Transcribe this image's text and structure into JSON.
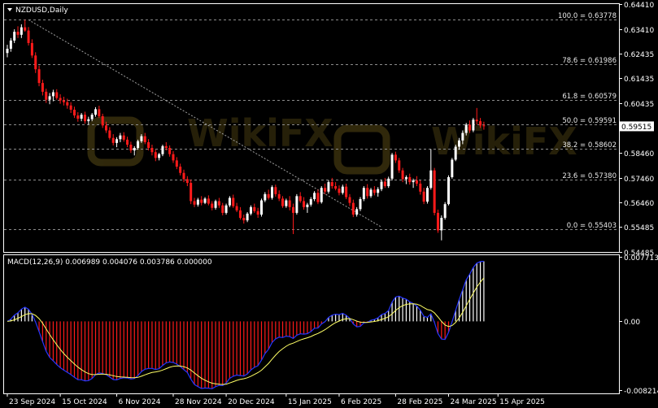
{
  "window": {
    "symbol_title": "NZDUSD,Daily",
    "indicator_title": "MACD(12,26,9) 0.006989 0.004076 0.003786 0.000000"
  },
  "colors": {
    "background": "#000000",
    "grid": "#8c8c8c",
    "bull_candle": "#ffffff",
    "bear_candle": "#ff1a1a",
    "trendline": "#a0a0a0",
    "macd_line": "#2636ff",
    "signal_line": "#ffff66",
    "hist_pos": "#ffffff",
    "hist_neg": "#ff1a1a",
    "price_tag_bg": "#ffffff",
    "price_tag_text": "#000000",
    "watermark": "#6b5a1a"
  },
  "chart_data": [
    {
      "type": "candlestick",
      "symbol": "NZDUSD",
      "timeframe": "Daily",
      "ylim": [
        0.54485,
        0.6441
      ],
      "price_ticks": [
        "0.64410",
        "0.63410",
        "0.62435",
        "0.61435",
        "0.60435",
        "0.59515",
        "0.58460",
        "0.57460",
        "0.56460",
        "0.55485",
        "0.54485"
      ],
      "current_price": "0.59515",
      "x_ticks": [
        "23 Sep 2024",
        "15 Oct 2024",
        "6 Nov 2024",
        "28 Nov 2024",
        "20 Dec 2024",
        "15 Jan 2025",
        "6 Feb 2025",
        "28 Feb 2025",
        "24 Mar 2025",
        "15 Apr 2025"
      ],
      "fibonacci": [
        {
          "label": "100.0 = 0.63778",
          "price": 0.63778
        },
        {
          "label": "78.6 = 0.61986",
          "price": 0.61986
        },
        {
          "label": "61.8 = 0.60579",
          "price": 0.60579
        },
        {
          "label": "50.0 = 0.59591",
          "price": 0.59591
        },
        {
          "label": "38.2 = 0.58602",
          "price": 0.58602
        },
        {
          "label": "23.6 = 0.57380",
          "price": 0.5738
        },
        {
          "label": "0.0 = 0.55403",
          "price": 0.55403
        }
      ],
      "trendline": {
        "from_index": 6,
        "from_price": 0.6378,
        "to_index": 106,
        "to_price": 0.5548
      },
      "candles": [
        [
          0.6245,
          0.6278,
          0.6228,
          0.6262
        ],
        [
          0.6262,
          0.6305,
          0.625,
          0.6295
        ],
        [
          0.6295,
          0.634,
          0.6285,
          0.633
        ],
        [
          0.633,
          0.6352,
          0.6305,
          0.6318
        ],
        [
          0.6318,
          0.636,
          0.6305,
          0.6348
        ],
        [
          0.6348,
          0.6378,
          0.633,
          0.6335
        ],
        [
          0.6335,
          0.6349,
          0.6275,
          0.6285
        ],
        [
          0.6285,
          0.63,
          0.6225,
          0.6235
        ],
        [
          0.6235,
          0.6248,
          0.6165,
          0.618
        ],
        [
          0.618,
          0.6195,
          0.6112,
          0.6125
        ],
        [
          0.6125,
          0.6138,
          0.6075,
          0.609
        ],
        [
          0.609,
          0.6102,
          0.6045,
          0.6058
        ],
        [
          0.6058,
          0.6085,
          0.604,
          0.6072
        ],
        [
          0.6072,
          0.6098,
          0.6052,
          0.6088
        ],
        [
          0.6088,
          0.61,
          0.6058,
          0.6065
        ],
        [
          0.6065,
          0.608,
          0.6042,
          0.6055
        ],
        [
          0.6055,
          0.607,
          0.6035,
          0.6048
        ],
        [
          0.6048,
          0.6062,
          0.6022,
          0.6035
        ],
        [
          0.6035,
          0.6048,
          0.6005,
          0.6018
        ],
        [
          0.6018,
          0.603,
          0.5985,
          0.5995
        ],
        [
          0.5995,
          0.6008,
          0.597,
          0.5982
        ],
        [
          0.5982,
          0.6005,
          0.5972,
          0.5998
        ],
        [
          0.5998,
          0.601,
          0.5962,
          0.5972
        ],
        [
          0.5972,
          0.599,
          0.5958,
          0.598
        ],
        [
          0.598,
          0.6005,
          0.5972,
          0.5998
        ],
        [
          0.5998,
          0.6028,
          0.599,
          0.602
        ],
        [
          0.602,
          0.6034,
          0.5985,
          0.5992
        ],
        [
          0.5992,
          0.6002,
          0.5945,
          0.5955
        ],
        [
          0.5955,
          0.597,
          0.5925,
          0.5935
        ],
        [
          0.5935,
          0.5948,
          0.5898,
          0.5905
        ],
        [
          0.5905,
          0.592,
          0.5875,
          0.5885
        ],
        [
          0.5885,
          0.5908,
          0.5868,
          0.59
        ],
        [
          0.59,
          0.5925,
          0.5888,
          0.5915
        ],
        [
          0.5915,
          0.5928,
          0.589,
          0.5898
        ],
        [
          0.5898,
          0.591,
          0.5868,
          0.5878
        ],
        [
          0.5878,
          0.589,
          0.5845,
          0.5855
        ],
        [
          0.5855,
          0.5872,
          0.5835,
          0.5865
        ],
        [
          0.5865,
          0.5898,
          0.5858,
          0.5892
        ],
        [
          0.5892,
          0.592,
          0.5885,
          0.5912
        ],
        [
          0.5912,
          0.5925,
          0.588,
          0.5888
        ],
        [
          0.5888,
          0.59,
          0.5855,
          0.5865
        ],
        [
          0.5865,
          0.5878,
          0.5835,
          0.5848
        ],
        [
          0.5848,
          0.5858,
          0.5812,
          0.5825
        ],
        [
          0.5825,
          0.5845,
          0.5815,
          0.584
        ],
        [
          0.584,
          0.5878,
          0.5832,
          0.5872
        ],
        [
          0.5872,
          0.5888,
          0.5855,
          0.5865
        ],
        [
          0.5865,
          0.5875,
          0.583,
          0.584
        ],
        [
          0.584,
          0.5852,
          0.5805,
          0.5815
        ],
        [
          0.5815,
          0.5828,
          0.578,
          0.579
        ],
        [
          0.579,
          0.5802,
          0.5755,
          0.5765
        ],
        [
          0.5765,
          0.5778,
          0.5728,
          0.574
        ],
        [
          0.574,
          0.5752,
          0.5712,
          0.5725
        ],
        [
          0.5725,
          0.5738,
          0.564,
          0.5652
        ],
        [
          0.5652,
          0.5665,
          0.5628,
          0.5638
        ],
        [
          0.5638,
          0.5665,
          0.563,
          0.5658
        ],
        [
          0.5658,
          0.5672,
          0.5635,
          0.5645
        ],
        [
          0.5645,
          0.5668,
          0.564,
          0.5662
        ],
        [
          0.5662,
          0.5675,
          0.5635,
          0.5642
        ],
        [
          0.5642,
          0.5652,
          0.5615,
          0.5625
        ],
        [
          0.5625,
          0.5658,
          0.5618,
          0.5652
        ],
        [
          0.5652,
          0.5665,
          0.5625,
          0.5635
        ],
        [
          0.5635,
          0.5645,
          0.5595,
          0.5605
        ],
        [
          0.5605,
          0.5642,
          0.5598,
          0.5635
        ],
        [
          0.5635,
          0.5672,
          0.5628,
          0.5665
        ],
        [
          0.5665,
          0.5678,
          0.5625,
          0.5632
        ],
        [
          0.5632,
          0.5645,
          0.5608,
          0.5615
        ],
        [
          0.5615,
          0.5628,
          0.5578,
          0.5585
        ],
        [
          0.5585,
          0.5598,
          0.5562,
          0.5575
        ],
        [
          0.5575,
          0.5608,
          0.5568,
          0.5602
        ],
        [
          0.5602,
          0.5635,
          0.5595,
          0.5628
        ],
        [
          0.5628,
          0.5642,
          0.5605,
          0.5612
        ],
        [
          0.5612,
          0.5625,
          0.5585,
          0.5598
        ],
        [
          0.5598,
          0.5662,
          0.559,
          0.5655
        ],
        [
          0.5655,
          0.5688,
          0.5648,
          0.568
        ],
        [
          0.568,
          0.5698,
          0.5658,
          0.5665
        ],
        [
          0.5665,
          0.5715,
          0.5658,
          0.5708
        ],
        [
          0.5708,
          0.5718,
          0.567,
          0.568
        ],
        [
          0.568,
          0.5695,
          0.5652,
          0.5662
        ],
        [
          0.5662,
          0.5672,
          0.5625,
          0.5632
        ],
        [
          0.5632,
          0.5662,
          0.5625,
          0.5655
        ],
        [
          0.5655,
          0.5672,
          0.5615,
          0.5628
        ],
        [
          0.5628,
          0.5642,
          0.552,
          0.5605
        ],
        [
          0.5605,
          0.568,
          0.5598,
          0.5672
        ],
        [
          0.5672,
          0.5688,
          0.5645,
          0.5652
        ],
        [
          0.5652,
          0.5668,
          0.5618,
          0.5628
        ],
        [
          0.5628,
          0.5645,
          0.5605,
          0.5638
        ],
        [
          0.5638,
          0.5668,
          0.563,
          0.566
        ],
        [
          0.566,
          0.5692,
          0.5652,
          0.5685
        ],
        [
          0.5685,
          0.5698,
          0.564,
          0.5648
        ],
        [
          0.5648,
          0.5712,
          0.5642,
          0.5705
        ],
        [
          0.5705,
          0.5722,
          0.568,
          0.569
        ],
        [
          0.569,
          0.5735,
          0.5682,
          0.5728
        ],
        [
          0.5728,
          0.5745,
          0.5702,
          0.5712
        ],
        [
          0.5712,
          0.5728,
          0.5695,
          0.5702
        ],
        [
          0.5702,
          0.5715,
          0.5675,
          0.5685
        ],
        [
          0.5685,
          0.5718,
          0.5678,
          0.571
        ],
        [
          0.571,
          0.5722,
          0.566,
          0.5668
        ],
        [
          0.5668,
          0.568,
          0.5632,
          0.5645
        ],
        [
          0.5645,
          0.5658,
          0.5588,
          0.5598
        ],
        [
          0.5598,
          0.5628,
          0.559,
          0.562
        ],
        [
          0.562,
          0.5668,
          0.5612,
          0.566
        ],
        [
          0.566,
          0.5712,
          0.5652,
          0.5705
        ],
        [
          0.5705,
          0.572,
          0.5662,
          0.5672
        ],
        [
          0.5672,
          0.5705,
          0.5665,
          0.5698
        ],
        [
          0.5698,
          0.5712,
          0.5675,
          0.5685
        ],
        [
          0.5685,
          0.5708,
          0.567,
          0.57
        ],
        [
          0.57,
          0.5738,
          0.5692,
          0.573
        ],
        [
          0.573,
          0.5745,
          0.5705,
          0.5712
        ],
        [
          0.5712,
          0.575,
          0.5705,
          0.5742
        ],
        [
          0.5742,
          0.5845,
          0.5735,
          0.5838
        ],
        [
          0.5838,
          0.585,
          0.5805,
          0.5815
        ],
        [
          0.5815,
          0.5825,
          0.5765,
          0.5775
        ],
        [
          0.5775,
          0.5785,
          0.5728,
          0.574
        ],
        [
          0.574,
          0.5755,
          0.572,
          0.5748
        ],
        [
          0.5748,
          0.5762,
          0.5718,
          0.5728
        ],
        [
          0.5728,
          0.5742,
          0.5705,
          0.5735
        ],
        [
          0.5735,
          0.5752,
          0.5712,
          0.5722
        ],
        [
          0.5722,
          0.5735,
          0.5678,
          0.569
        ],
        [
          0.569,
          0.5705,
          0.564,
          0.565
        ],
        [
          0.565,
          0.5712,
          0.5642,
          0.5705
        ],
        [
          0.5705,
          0.586,
          0.5698,
          0.5775
        ],
        [
          0.5775,
          0.5785,
          0.5595,
          0.5605
        ],
        [
          0.5605,
          0.5618,
          0.5525,
          0.5535
        ],
        [
          0.5535,
          0.5595,
          0.5495,
          0.5585
        ],
        [
          0.5585,
          0.5648,
          0.5578,
          0.564
        ],
        [
          0.564,
          0.5755,
          0.5635,
          0.5748
        ],
        [
          0.5748,
          0.5825,
          0.5742,
          0.5818
        ],
        [
          0.5818,
          0.5878,
          0.5812,
          0.587
        ],
        [
          0.587,
          0.5905,
          0.5858,
          0.5895
        ],
        [
          0.5895,
          0.5935,
          0.588,
          0.5925
        ],
        [
          0.5925,
          0.5965,
          0.5915,
          0.5958
        ],
        [
          0.5958,
          0.5975,
          0.5925,
          0.5935
        ],
        [
          0.5935,
          0.5985,
          0.5928,
          0.5978
        ],
        [
          0.5978,
          0.6025,
          0.5958,
          0.5972
        ],
        [
          0.5972,
          0.5985,
          0.5945,
          0.5955
        ],
        [
          0.5955,
          0.597,
          0.5938,
          0.5952
        ]
      ]
    },
    {
      "type": "line",
      "name": "MACD(12,26,9)",
      "values_printed": [
        "0.006989",
        "0.004076",
        "0.003786",
        "0.000000"
      ],
      "ylim": [
        -0.008214,
        0.007713
      ],
      "y_ticks": [
        "0.007713",
        "0.00",
        "-0.008214"
      ]
    }
  ]
}
